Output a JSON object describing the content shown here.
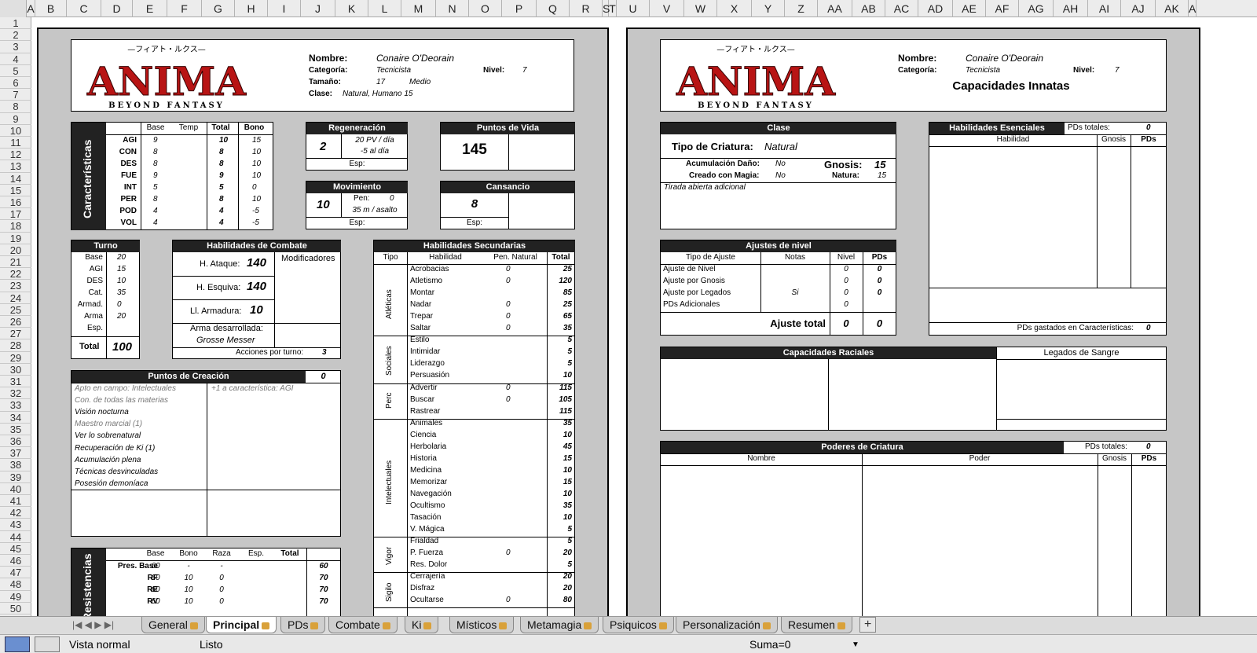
{
  "columns": [
    "A",
    "B",
    "C",
    "D",
    "E",
    "F",
    "G",
    "H",
    "I",
    "J",
    "K",
    "L",
    "M",
    "N",
    "O",
    "P",
    "Q",
    "R",
    "S",
    "T",
    "U",
    "V",
    "W",
    "X",
    "Y",
    "Z",
    "AA",
    "AB",
    "AC",
    "AD",
    "AE",
    "AF",
    "AG",
    "AH",
    "AI",
    "AJ",
    "AK",
    "A"
  ],
  "rows": [
    "1",
    "2",
    "3",
    "4",
    "5",
    "6",
    "7",
    "8",
    "9",
    "10",
    "11",
    "12",
    "13",
    "14",
    "15",
    "16",
    "17",
    "18",
    "19",
    "20",
    "21",
    "22",
    "23",
    "24",
    "25",
    "26",
    "27",
    "28",
    "29",
    "30",
    "31",
    "32",
    "33",
    "34",
    "35",
    "36",
    "37",
    "38",
    "39",
    "40",
    "41",
    "42",
    "43",
    "44",
    "45",
    "46",
    "47",
    "48",
    "49",
    "50"
  ],
  "logo": {
    "small": "—フィアト・ルクス—",
    "main": "ANIMA",
    "sub": "BEYOND FANTASY"
  },
  "header": {
    "nombre_l": "Nombre:",
    "nombre": "Conaire O'Deorain",
    "cat_l": "Categoría:",
    "cat": "Tecnicista",
    "nivel_l": "Nivel:",
    "nivel": "7",
    "tam_l": "Tamaño:",
    "tam": "17",
    "tam2": "Medio",
    "clase_l": "Clase:",
    "clase": "Natural, Humano 15"
  },
  "caract": {
    "title": "Características",
    "cols": [
      "Base",
      "Temp",
      "Total",
      "Bono"
    ],
    "rows": [
      [
        "AGI",
        "9",
        "",
        "10",
        "15"
      ],
      [
        "CON",
        "8",
        "",
        "8",
        "10"
      ],
      [
        "DES",
        "8",
        "",
        "8",
        "10"
      ],
      [
        "FUE",
        "9",
        "",
        "9",
        "10"
      ],
      [
        "INT",
        "5",
        "",
        "5",
        "0"
      ],
      [
        "PER",
        "8",
        "",
        "8",
        "10"
      ],
      [
        "POD",
        "4",
        "",
        "4",
        "-5"
      ],
      [
        "VOL",
        "4",
        "",
        "4",
        "-5"
      ]
    ]
  },
  "regen": {
    "title": "Regeneración",
    "val": "2",
    "l1": "20 PV / día",
    "l2": "-5 al día",
    "esp": "Esp:"
  },
  "pv": {
    "title": "Puntos de Vida",
    "val": "145"
  },
  "mov": {
    "title": "Movimiento",
    "val": "10",
    "pen_l": "Pen:",
    "pen": "0",
    "l2": "35 m / asalto",
    "esp": "Esp:"
  },
  "cans": {
    "title": "Cansancio",
    "val": "8",
    "esp": "Esp:"
  },
  "turno": {
    "title": "Turno",
    "rows": [
      [
        "Base",
        "20"
      ],
      [
        "AGI",
        "15"
      ],
      [
        "DES",
        "10"
      ],
      [
        "Cat.",
        "35"
      ],
      [
        "Armad.",
        "0"
      ],
      [
        "Arma",
        "20"
      ],
      [
        "Esp.",
        ""
      ]
    ],
    "total_l": "Total",
    "total": "100"
  },
  "combate": {
    "title": "Habilidades de Combate",
    "ataque_l": "H. Ataque:",
    "ataque": "140",
    "esquiva_l": "H. Esquiva:",
    "esquiva": "140",
    "armad_l": "Ll. Armadura:",
    "armad": "10",
    "mod": "Modificadores",
    "arma_l": "Arma desarrollada:",
    "arma": "Grosse Messer",
    "acc_l": "Acciones por turno:",
    "acc": "3"
  },
  "creacion": {
    "title": "Puntos de Creación",
    "val": "0",
    "left": [
      "Apto en campo: Intelectuales",
      "Con. de todas las materias",
      "Visión nocturna",
      "Maestro marcial (1)",
      "Ver lo sobrenatural",
      "Recuperación de Ki (1)",
      "Acumulación plena",
      "Técnicas desvinculadas",
      "Posesión demoníaca"
    ],
    "right": "+1 a característica: AGI"
  },
  "secund": {
    "title": "Habilidades Secundarias",
    "cols": [
      "Tipo",
      "Habilidad",
      "Pen. Natural",
      "Total"
    ],
    "groups": [
      {
        "name": "Atléticas",
        "rows": [
          [
            "Acrobacias",
            "0",
            "25"
          ],
          [
            "Atletismo",
            "0",
            "120"
          ],
          [
            "Montar",
            "",
            "85"
          ],
          [
            "Nadar",
            "0",
            "25"
          ],
          [
            "Trepar",
            "0",
            "65"
          ],
          [
            "Saltar",
            "0",
            "35"
          ]
        ]
      },
      {
        "name": "Sociales",
        "rows": [
          [
            "Estilo",
            "",
            "5"
          ],
          [
            "Intimidar",
            "",
            "5"
          ],
          [
            "Liderazgo",
            "",
            "5"
          ],
          [
            "Persuasión",
            "",
            "10"
          ]
        ]
      },
      {
        "name": "Perc",
        "rows": [
          [
            "Advertir",
            "0",
            "115"
          ],
          [
            "Buscar",
            "0",
            "105"
          ],
          [
            "Rastrear",
            "",
            "115"
          ]
        ]
      },
      {
        "name": "Intelectuales",
        "rows": [
          [
            "Animales",
            "",
            "35"
          ],
          [
            "Ciencia",
            "",
            "10"
          ],
          [
            "Herbolaria",
            "",
            "45"
          ],
          [
            "Historia",
            "",
            "15"
          ],
          [
            "Medicina",
            "",
            "10"
          ],
          [
            "Memorizar",
            "",
            "15"
          ],
          [
            "Navegación",
            "",
            "10"
          ],
          [
            "Ocultismo",
            "",
            "35"
          ],
          [
            "Tasación",
            "",
            "10"
          ],
          [
            "V. Mágica",
            "",
            "5"
          ]
        ]
      },
      {
        "name": "Vigor",
        "rows": [
          [
            "Frialdad",
            "",
            "5"
          ],
          [
            "P. Fuerza",
            "0",
            "20"
          ],
          [
            "Res. Dolor",
            "",
            "5"
          ]
        ]
      },
      {
        "name": "Sigilo",
        "rows": [
          [
            "Cerrajería",
            "",
            "20"
          ],
          [
            "Disfraz",
            "",
            "20"
          ],
          [
            "Ocultarse",
            "0",
            "80"
          ]
        ]
      }
    ]
  },
  "resist": {
    "title": "Resistencias",
    "cols": [
      "Base",
      "Bono",
      "Raza",
      "Esp.",
      "Total"
    ],
    "rows": [
      [
        "Pres. Base",
        "60",
        "-",
        "-",
        "",
        "60"
      ],
      [
        "RF",
        "60",
        "10",
        "0",
        "",
        "70"
      ],
      [
        "RE",
        "60",
        "10",
        "0",
        "",
        "70"
      ],
      [
        "RV",
        "60",
        "10",
        "0",
        "",
        "70"
      ]
    ]
  },
  "right": {
    "subtitle": "Capacidades Innatas",
    "clase": {
      "title": "Clase",
      "tipo_l": "Tipo de Criatura:",
      "tipo": "Natural",
      "acum_l": "Acumulación Daño:",
      "acum": "No",
      "gnosis_l": "Gnosis:",
      "gnosis": "15",
      "magia_l": "Creado con Magia:",
      "magia": "No",
      "natura_l": "Natura:",
      "natura": "15",
      "tirada": "Tirada abierta adicional"
    },
    "esenc": {
      "title": "Habilidades Esenciales",
      "pds_l": "PDs totales:",
      "pds": "0",
      "cols": [
        "Habilidad",
        "Gnosis",
        "PDs"
      ],
      "gastados_l": "PDs gastados en Características:",
      "gastados": "0"
    },
    "ajustes": {
      "title": "Ajustes de nivel",
      "cols": [
        "Tipo de Ajuste",
        "Notas",
        "Nivel",
        "PDs"
      ],
      "rows": [
        [
          "Ajuste de Nivel",
          "",
          "0",
          "0"
        ],
        [
          "Ajuste por Gnosis",
          "",
          "0",
          "0"
        ],
        [
          "Ajuste por Legados",
          "Si",
          "0",
          "0"
        ],
        [
          "PDs Adicionales",
          "",
          "0",
          ""
        ]
      ],
      "total_l": "Ajuste total",
      "total_n": "0",
      "total_p": "0"
    },
    "raciales": {
      "title": "Capacidades Raciales",
      "legados": "Legados de Sangre"
    },
    "poderes": {
      "title": "Poderes de Criatura",
      "pds_l": "PDs totales:",
      "pds": "0",
      "cols": [
        "Nombre",
        "Poder",
        "Gnosis",
        "PDs"
      ]
    }
  },
  "tabs": [
    "General",
    "Principal",
    "PDs",
    "Combate",
    "Ki",
    "Místicos",
    "Metamagia",
    "Psiquicos",
    "Personalización",
    "Resumen"
  ],
  "tabs_active": "Principal",
  "status": {
    "view": "Vista normal",
    "ready": "Listo",
    "sum": "Suma=0"
  }
}
